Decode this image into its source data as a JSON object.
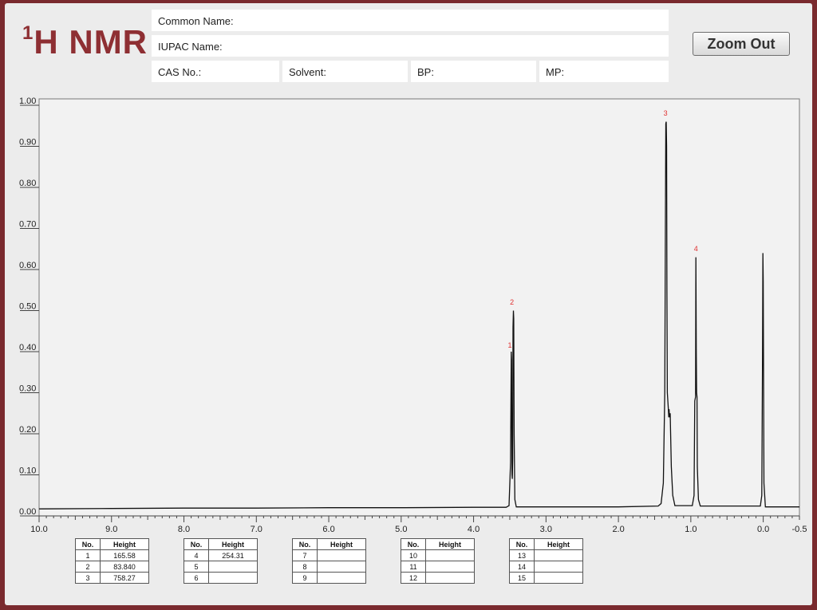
{
  "header": {
    "title_sup": "1",
    "title_main": "H NMR",
    "zoom_label": "Zoom Out"
  },
  "fields": {
    "common_name": "Common Name:",
    "iupac_name": "IUPAC Name:",
    "cas_no": "CAS No.:",
    "solvent": "Solvent:",
    "bp": "BP:",
    "mp": "MP:"
  },
  "chart_data": {
    "type": "line",
    "title": "",
    "xlabel": "",
    "ylabel": "",
    "xlim": [
      10.0,
      -0.5
    ],
    "ylim": [
      0.0,
      1.0
    ],
    "x_reversed": true,
    "xticks": [
      "10.0",
      "9.0",
      "8.0",
      "7.0",
      "6.0",
      "5.0",
      "4.0",
      "3.0",
      "2.0",
      "1.0",
      "0.0",
      "-0.5"
    ],
    "xtick_values": [
      10,
      9,
      8,
      7,
      6,
      5,
      4,
      3,
      2,
      1,
      0,
      -0.5
    ],
    "yticks": [
      "0.00",
      "0.10",
      "0.20",
      "0.30",
      "0.40",
      "0.50",
      "0.60",
      "0.70",
      "0.80",
      "0.90",
      "1.00"
    ],
    "ytick_values": [
      0,
      0.1,
      0.2,
      0.3,
      0.4,
      0.5,
      0.6,
      0.7,
      0.8,
      0.9,
      1.0
    ],
    "baseline": 0.02,
    "spectrum_points": [
      [
        10.0,
        0.017
      ],
      [
        9.0,
        0.018
      ],
      [
        8.0,
        0.019
      ],
      [
        7.0,
        0.019
      ],
      [
        6.0,
        0.02
      ],
      [
        5.0,
        0.02
      ],
      [
        4.0,
        0.021
      ],
      [
        3.55,
        0.021
      ],
      [
        3.51,
        0.025
      ],
      [
        3.49,
        0.13
      ],
      [
        3.48,
        0.4
      ],
      [
        3.475,
        0.38
      ],
      [
        3.47,
        0.1
      ],
      [
        3.465,
        0.09
      ],
      [
        3.46,
        0.14
      ],
      [
        3.455,
        0.46
      ],
      [
        3.45,
        0.5
      ],
      [
        3.445,
        0.48
      ],
      [
        3.44,
        0.2
      ],
      [
        3.43,
        0.04
      ],
      [
        3.41,
        0.022
      ],
      [
        2.0,
        0.022
      ],
      [
        1.45,
        0.024
      ],
      [
        1.41,
        0.03
      ],
      [
        1.38,
        0.08
      ],
      [
        1.36,
        0.3
      ],
      [
        1.35,
        0.75
      ],
      [
        1.345,
        0.955
      ],
      [
        1.34,
        0.96
      ],
      [
        1.335,
        0.9
      ],
      [
        1.33,
        0.55
      ],
      [
        1.325,
        0.3
      ],
      [
        1.31,
        0.26
      ],
      [
        1.305,
        0.24
      ],
      [
        1.3,
        0.26
      ],
      [
        1.295,
        0.24
      ],
      [
        1.285,
        0.25
      ],
      [
        1.27,
        0.12
      ],
      [
        1.25,
        0.05
      ],
      [
        1.22,
        0.025
      ],
      [
        0.98,
        0.025
      ],
      [
        0.955,
        0.05
      ],
      [
        0.945,
        0.28
      ],
      [
        0.935,
        0.29
      ],
      [
        0.93,
        0.63
      ],
      [
        0.925,
        0.4
      ],
      [
        0.92,
        0.3
      ],
      [
        0.915,
        0.29
      ],
      [
        0.91,
        0.12
      ],
      [
        0.895,
        0.04
      ],
      [
        0.87,
        0.024
      ],
      [
        0.04,
        0.024
      ],
      [
        0.02,
        0.05
      ],
      [
        0.01,
        0.38
      ],
      [
        0.005,
        0.64
      ],
      [
        0.0,
        0.57
      ],
      [
        -0.005,
        0.3
      ],
      [
        -0.01,
        0.08
      ],
      [
        -0.03,
        0.022
      ],
      [
        -0.5,
        0.022
      ]
    ],
    "peak_labels": [
      {
        "label": "1",
        "x": 3.5,
        "y": 0.41
      },
      {
        "label": "2",
        "x": 3.47,
        "y": 0.515
      },
      {
        "label": "3",
        "x": 1.35,
        "y": 0.975
      },
      {
        "label": "4",
        "x": 0.93,
        "y": 0.645
      }
    ],
    "grid": false
  },
  "peak_tables": [
    {
      "col_no": "No.",
      "col_height": "Height",
      "rows": [
        {
          "no": "1",
          "height": "165.58"
        },
        {
          "no": "2",
          "height": "83.840"
        },
        {
          "no": "3",
          "height": "758.27"
        }
      ]
    },
    {
      "col_no": "No.",
      "col_height": "Height",
      "rows": [
        {
          "no": "4",
          "height": "254.31"
        },
        {
          "no": "5",
          "height": ""
        },
        {
          "no": "6",
          "height": ""
        }
      ]
    },
    {
      "col_no": "No.",
      "col_height": "Height",
      "rows": [
        {
          "no": "7",
          "height": ""
        },
        {
          "no": "8",
          "height": ""
        },
        {
          "no": "9",
          "height": ""
        }
      ]
    },
    {
      "col_no": "No.",
      "col_height": "Height",
      "rows": [
        {
          "no": "10",
          "height": ""
        },
        {
          "no": "11",
          "height": ""
        },
        {
          "no": "12",
          "height": ""
        }
      ]
    },
    {
      "col_no": "No.",
      "col_height": "Height",
      "rows": [
        {
          "no": "13",
          "height": ""
        },
        {
          "no": "14",
          "height": ""
        },
        {
          "no": "15",
          "height": ""
        }
      ]
    }
  ],
  "colors": {
    "title": "#8e2f33",
    "frame": "#7a2a2e",
    "peak_label": "#e03030",
    "trace": "#111111"
  }
}
